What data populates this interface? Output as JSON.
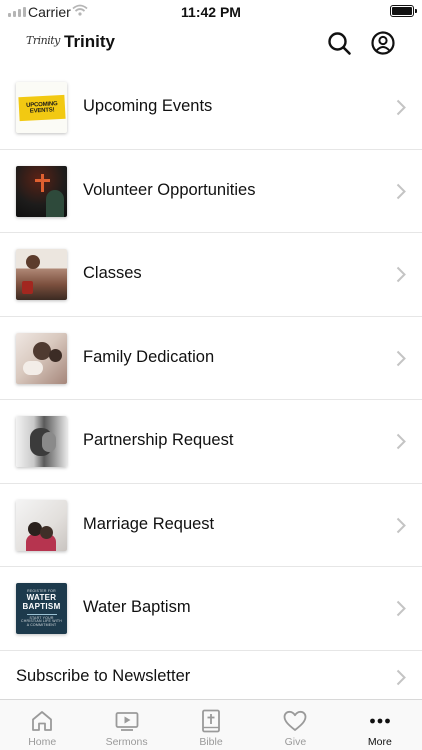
{
  "status_bar": {
    "carrier": "Carrier",
    "time": "11:42 PM",
    "battery_level": 1.0
  },
  "header": {
    "logo_text": "Trinity",
    "title": "Trinity",
    "icons": [
      "search-icon",
      "account-icon"
    ]
  },
  "menu": {
    "items": [
      {
        "label": "Upcoming Events",
        "thumbnail_text": [
          "UPCOMING",
          "EVENTS!"
        ]
      },
      {
        "label": "Volunteer Opportunities"
      },
      {
        "label": "Classes"
      },
      {
        "label": "Family Dedication"
      },
      {
        "label": "Partnership Request"
      },
      {
        "label": "Marriage Request"
      },
      {
        "label": "Water Baptism",
        "thumbnail_text": [
          "REGISTER FOR",
          "WATER",
          "BAPTISM",
          "START YOUR",
          "CHRISTIAN LIFE WITH",
          "A COMMITMENT"
        ]
      },
      {
        "label": "Subscribe to Newsletter"
      }
    ]
  },
  "tabbar": {
    "tabs": [
      {
        "label": "Home",
        "icon": "home-icon",
        "active": false
      },
      {
        "label": "Sermons",
        "icon": "video-icon",
        "active": false
      },
      {
        "label": "Bible",
        "icon": "bible-icon",
        "active": false
      },
      {
        "label": "Give",
        "icon": "heart-icon",
        "active": false
      },
      {
        "label": "More",
        "icon": "more-icon",
        "active": true
      }
    ]
  },
  "colors": {
    "active_tab": "#111111",
    "inactive_tab": "#9a9a9a",
    "divider": "#e6e6e6",
    "chevron": "#c4c4c4"
  }
}
